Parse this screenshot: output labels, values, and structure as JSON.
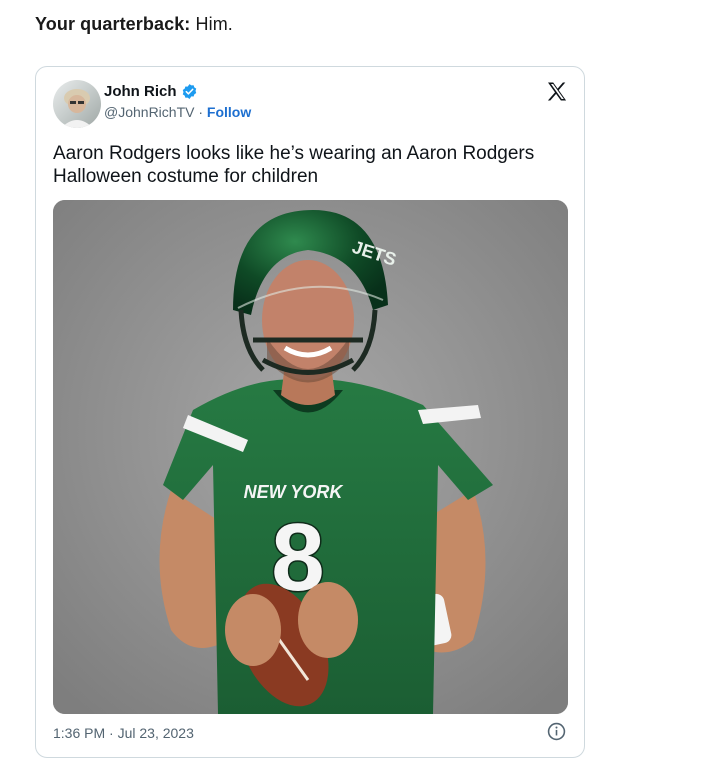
{
  "caption": {
    "prefix": "Your quarterback:",
    "text": "Him."
  },
  "tweet": {
    "author_name": "John Rich",
    "handle": "@JohnRichTV",
    "separator": "·",
    "follow_label": "Follow",
    "text": "Aaron Rodgers looks like he’s wearing an Aaron Rodgers Halloween costume for children",
    "timestamp": "1:36 PM · Jul 23, 2023",
    "jersey_text": "NEW YORK",
    "jersey_number": "8",
    "helmet_text": "JETS"
  },
  "colors": {
    "verified": "#1d9bf0",
    "follow": "#1d6fd0",
    "jersey_green": "#1f6b3a",
    "background_gray": "#8f8f8f"
  },
  "icons": [
    "verified-badge-icon",
    "x-logo-icon",
    "info-icon"
  ]
}
